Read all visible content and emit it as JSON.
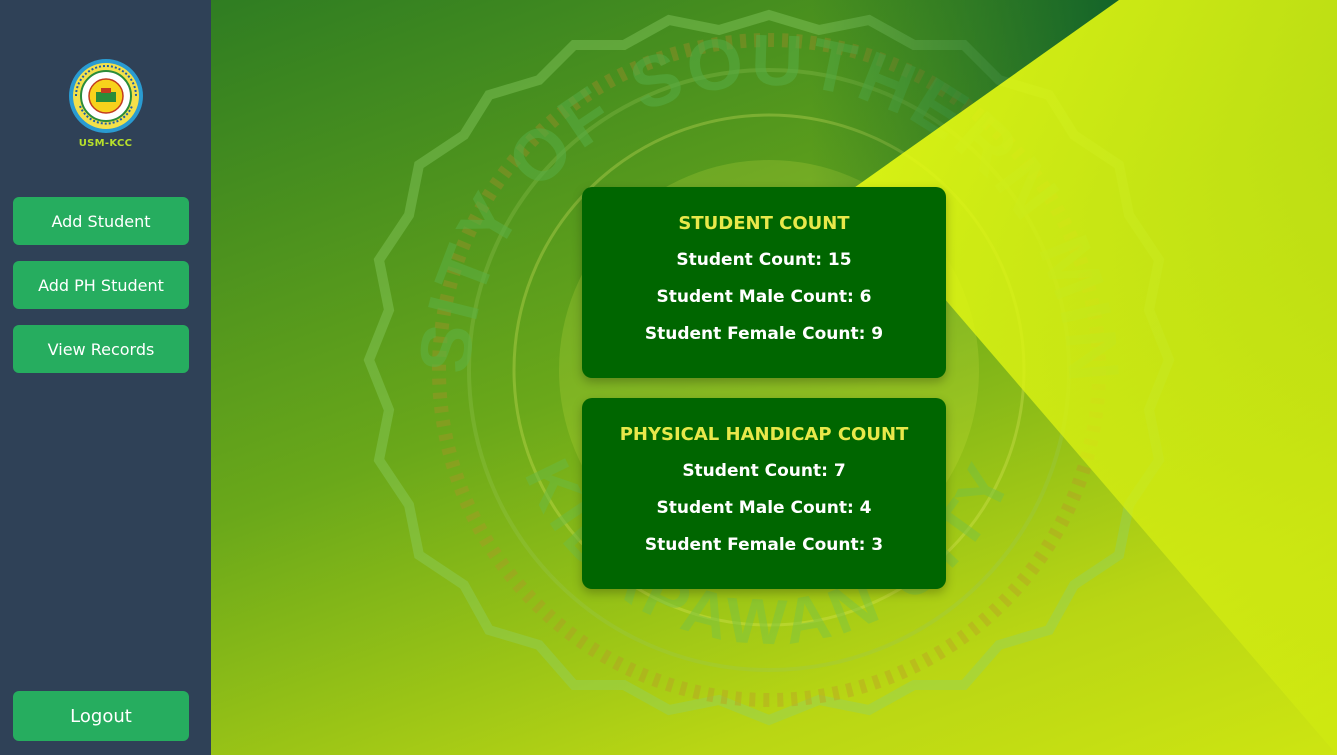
{
  "sidebar": {
    "logo_label": "USM-KCC",
    "buttons": {
      "add_student": "Add Student",
      "add_ph_student": "Add PH Student",
      "view_records": "View Records",
      "logout": "Logout"
    }
  },
  "background": {
    "seal_top_text": "UNIVERSITY OF SOUTHERN MINDANAO",
    "seal_bottom_text": "KIDAPAWAN CITY"
  },
  "cards": {
    "student": {
      "title": "STUDENT COUNT",
      "count": "Student Count: 15",
      "male": "Student Male Count: 6",
      "female": "Student Female Count: 9"
    },
    "ph": {
      "title": "PHYSICAL HANDICAP COUNT",
      "count": "Student Count: 7",
      "male": "Student Male Count: 4",
      "female": "Student Female Count: 3"
    }
  },
  "colors": {
    "sidebar_bg": "#2f4157",
    "button_bg": "#26ad5f",
    "card_bg": "#006600",
    "card_title": "#e8e84a",
    "accent_yellow": "#e4fb14"
  }
}
